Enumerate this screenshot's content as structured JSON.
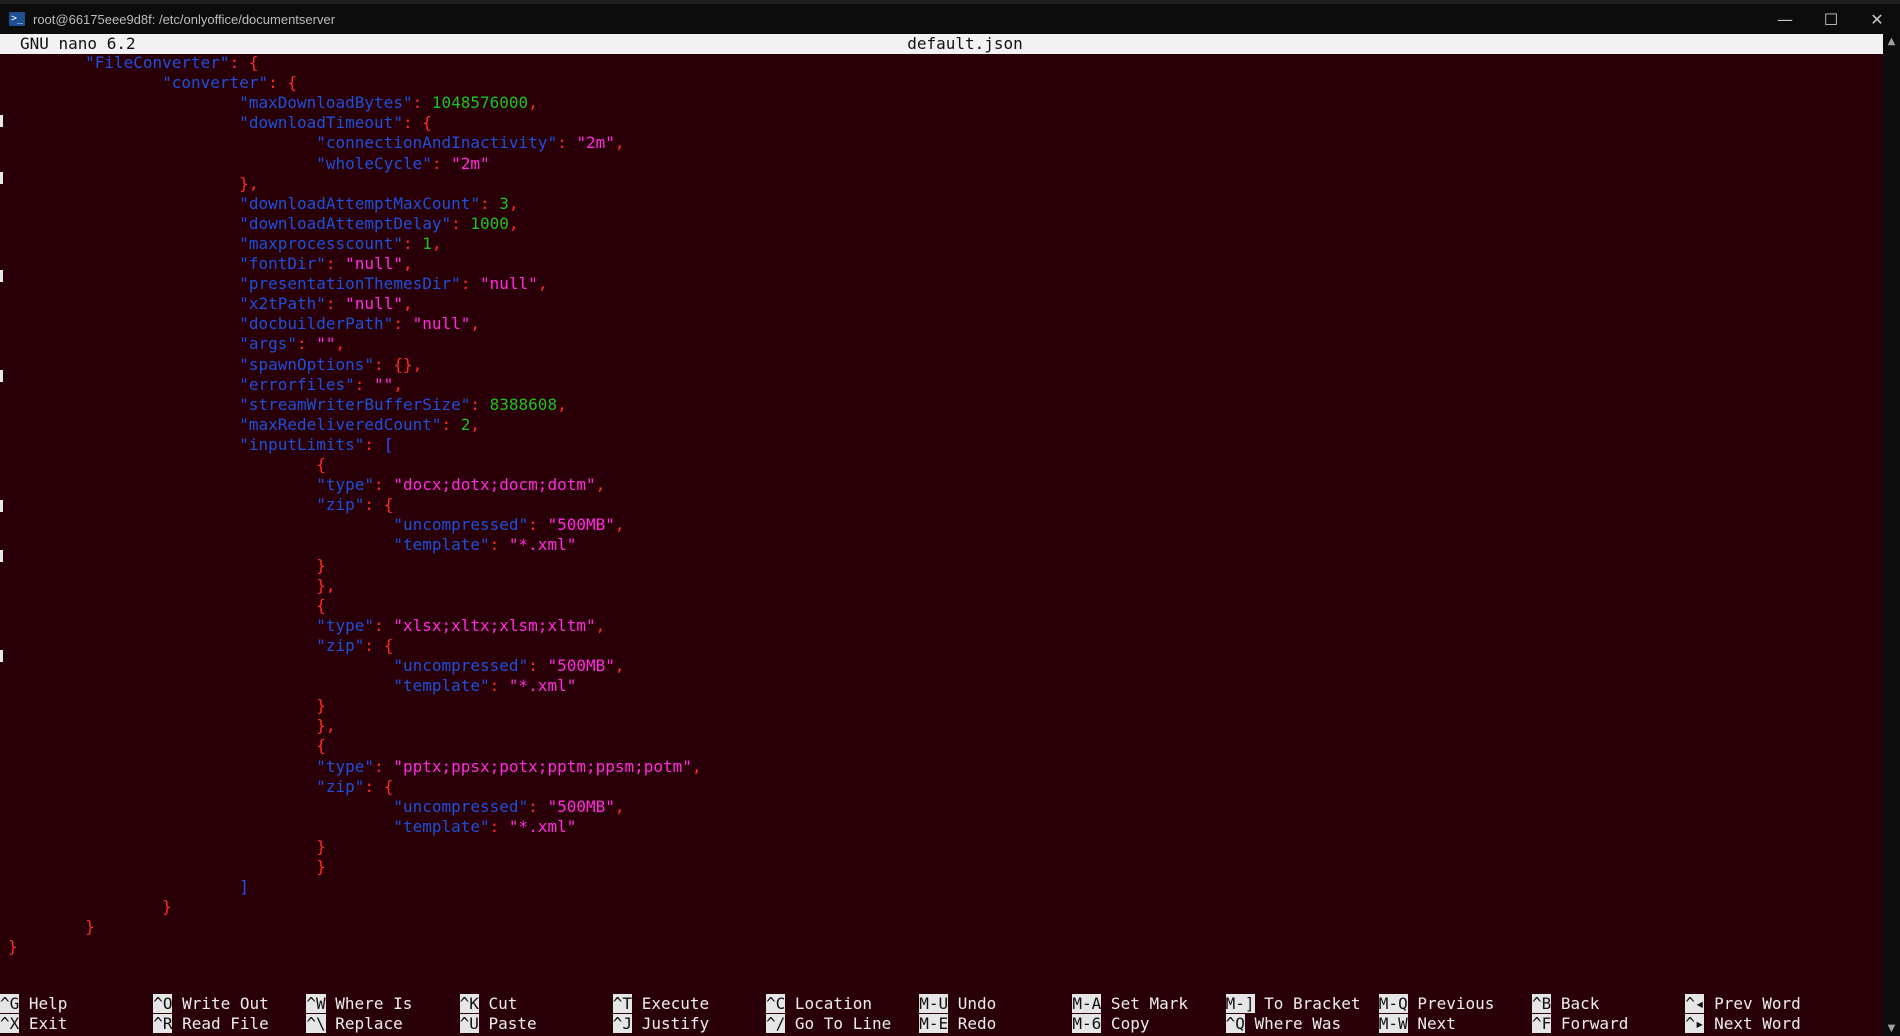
{
  "window": {
    "title": "root@66175eee9d8f: /etc/onlyoffice/documentserver",
    "icon": "powershell-icon",
    "buttons": {
      "minimize": "—",
      "maximize": "☐",
      "close": "✕"
    }
  },
  "nano": {
    "version": "GNU nano 6.2",
    "filename": "default.json"
  },
  "editor": {
    "lines": [
      [
        [
          "k",
          "\t\"FileConverter\""
        ],
        [
          "p",
          ": {"
        ]
      ],
      [
        [
          "k",
          "\t\t\"converter\""
        ],
        [
          "p",
          ": {"
        ]
      ],
      [
        [
          "k",
          "\t\t\t\"maxDownloadBytes\""
        ],
        [
          "p",
          ": "
        ],
        [
          "n",
          "1048576000"
        ],
        [
          "p",
          ","
        ]
      ],
      [
        [
          "k",
          "\t\t\t\"downloadTimeout\""
        ],
        [
          "p",
          ": {"
        ]
      ],
      [
        [
          "k",
          "\t\t\t\t\"connectionAndInactivity\""
        ],
        [
          "p",
          ": "
        ],
        [
          "s",
          "\"2m\""
        ],
        [
          "p",
          ","
        ]
      ],
      [
        [
          "k",
          "\t\t\t\t\"wholeCycle\""
        ],
        [
          "p",
          ": "
        ],
        [
          "s",
          "\"2m\""
        ]
      ],
      [
        [
          "p",
          "\t\t\t},"
        ]
      ],
      [
        [
          "k",
          "\t\t\t\"downloadAttemptMaxCount\""
        ],
        [
          "p",
          ": "
        ],
        [
          "n",
          "3"
        ],
        [
          "p",
          ","
        ]
      ],
      [
        [
          "k",
          "\t\t\t\"downloadAttemptDelay\""
        ],
        [
          "p",
          ": "
        ],
        [
          "n",
          "1000"
        ],
        [
          "p",
          ","
        ]
      ],
      [
        [
          "k",
          "\t\t\t\"maxprocesscount\""
        ],
        [
          "p",
          ": "
        ],
        [
          "n",
          "1"
        ],
        [
          "p",
          ","
        ]
      ],
      [
        [
          "k",
          "\t\t\t\"fontDir\""
        ],
        [
          "p",
          ": "
        ],
        [
          "s",
          "\"null\""
        ],
        [
          "p",
          ","
        ]
      ],
      [
        [
          "k",
          "\t\t\t\"presentationThemesDir\""
        ],
        [
          "p",
          ": "
        ],
        [
          "s",
          "\"null\""
        ],
        [
          "p",
          ","
        ]
      ],
      [
        [
          "k",
          "\t\t\t\"x2tPath\""
        ],
        [
          "p",
          ": "
        ],
        [
          "s",
          "\"null\""
        ],
        [
          "p",
          ","
        ]
      ],
      [
        [
          "k",
          "\t\t\t\"docbuilderPath\""
        ],
        [
          "p",
          ": "
        ],
        [
          "s",
          "\"null\""
        ],
        [
          "p",
          ","
        ]
      ],
      [
        [
          "k",
          "\t\t\t\"args\""
        ],
        [
          "p",
          ": "
        ],
        [
          "s",
          "\"\""
        ],
        [
          "p",
          ","
        ]
      ],
      [
        [
          "k",
          "\t\t\t\"spawnOptions\""
        ],
        [
          "p",
          ": {},"
        ]
      ],
      [
        [
          "k",
          "\t\t\t\"errorfiles\""
        ],
        [
          "p",
          ": "
        ],
        [
          "s",
          "\"\""
        ],
        [
          "p",
          ","
        ]
      ],
      [
        [
          "k",
          "\t\t\t\"streamWriterBufferSize\""
        ],
        [
          "p",
          ": "
        ],
        [
          "n",
          "8388608"
        ],
        [
          "p",
          ","
        ]
      ],
      [
        [
          "k",
          "\t\t\t\"maxRedeliveredCount\""
        ],
        [
          "p",
          ": "
        ],
        [
          "n",
          "2"
        ],
        [
          "p",
          ","
        ]
      ],
      [
        [
          "k",
          "\t\t\t\"inputLimits\""
        ],
        [
          "p",
          ": "
        ],
        [
          "b",
          "["
        ]
      ],
      [
        [
          "p",
          "\t\t\t\t{"
        ]
      ],
      [
        [
          "k",
          "\t\t\t\t\"type\""
        ],
        [
          "p",
          ": "
        ],
        [
          "s",
          "\"docx;dotx;docm;dotm\""
        ],
        [
          "p",
          ","
        ]
      ],
      [
        [
          "k",
          "\t\t\t\t\"zip\""
        ],
        [
          "p",
          ": {"
        ]
      ],
      [
        [
          "k",
          "\t\t\t\t\t\"uncompressed\""
        ],
        [
          "p",
          ": "
        ],
        [
          "s",
          "\"500MB\""
        ],
        [
          "p",
          ","
        ]
      ],
      [
        [
          "k",
          "\t\t\t\t\t\"template\""
        ],
        [
          "p",
          ": "
        ],
        [
          "s",
          "\"*.xml\""
        ]
      ],
      [
        [
          "p",
          "\t\t\t\t}"
        ]
      ],
      [
        [
          "p",
          "\t\t\t\t},"
        ]
      ],
      [
        [
          "p",
          "\t\t\t\t{"
        ]
      ],
      [
        [
          "k",
          "\t\t\t\t\"type\""
        ],
        [
          "p",
          ": "
        ],
        [
          "s",
          "\"xlsx;xltx;xlsm;xltm\""
        ],
        [
          "p",
          ","
        ]
      ],
      [
        [
          "k",
          "\t\t\t\t\"zip\""
        ],
        [
          "p",
          ": {"
        ]
      ],
      [
        [
          "k",
          "\t\t\t\t\t\"uncompressed\""
        ],
        [
          "p",
          ": "
        ],
        [
          "s",
          "\"500MB\""
        ],
        [
          "p",
          ","
        ]
      ],
      [
        [
          "k",
          "\t\t\t\t\t\"template\""
        ],
        [
          "p",
          ": "
        ],
        [
          "s",
          "\"*.xml\""
        ]
      ],
      [
        [
          "p",
          "\t\t\t\t}"
        ]
      ],
      [
        [
          "p",
          "\t\t\t\t},"
        ]
      ],
      [
        [
          "p",
          "\t\t\t\t{"
        ]
      ],
      [
        [
          "k",
          "\t\t\t\t\"type\""
        ],
        [
          "p",
          ": "
        ],
        [
          "s",
          "\"pptx;ppsx;potx;pptm;ppsm;potm\""
        ],
        [
          "p",
          ","
        ]
      ],
      [
        [
          "k",
          "\t\t\t\t\"zip\""
        ],
        [
          "p",
          ": {"
        ]
      ],
      [
        [
          "k",
          "\t\t\t\t\t\"uncompressed\""
        ],
        [
          "p",
          ": "
        ],
        [
          "s",
          "\"500MB\""
        ],
        [
          "p",
          ","
        ]
      ],
      [
        [
          "k",
          "\t\t\t\t\t\"template\""
        ],
        [
          "p",
          ": "
        ],
        [
          "s",
          "\"*.xml\""
        ]
      ],
      [
        [
          "p",
          "\t\t\t\t}"
        ]
      ],
      [
        [
          "p",
          "\t\t\t\t}"
        ]
      ],
      [
        [
          "b",
          "\t\t\t]"
        ]
      ],
      [
        [
          "p",
          "\t\t}"
        ]
      ],
      [
        [
          "p",
          "\t}"
        ]
      ],
      [
        [
          "p",
          "}"
        ]
      ]
    ]
  },
  "shortcuts": [
    [
      {
        "key": "^G",
        "label": "Help"
      },
      {
        "key": "^X",
        "label": "Exit"
      }
    ],
    [
      {
        "key": "^O",
        "label": "Write Out"
      },
      {
        "key": "^R",
        "label": "Read File"
      }
    ],
    [
      {
        "key": "^W",
        "label": "Where Is"
      },
      {
        "key": "^\\",
        "label": "Replace"
      }
    ],
    [
      {
        "key": "^K",
        "label": "Cut"
      },
      {
        "key": "^U",
        "label": "Paste"
      }
    ],
    [
      {
        "key": "^T",
        "label": "Execute"
      },
      {
        "key": "^J",
        "label": "Justify"
      }
    ],
    [
      {
        "key": "^C",
        "label": "Location"
      },
      {
        "key": "^/",
        "label": "Go To Line"
      }
    ],
    [
      {
        "key": "M-U",
        "label": "Undo"
      },
      {
        "key": "M-E",
        "label": "Redo"
      }
    ],
    [
      {
        "key": "M-A",
        "label": "Set Mark"
      },
      {
        "key": "M-6",
        "label": "Copy"
      }
    ],
    [
      {
        "key": "M-]",
        "label": "To Bracket"
      },
      {
        "key": "^Q",
        "label": "Where Was"
      }
    ],
    [
      {
        "key": "M-Q",
        "label": "Previous"
      },
      {
        "key": "M-W",
        "label": "Next"
      }
    ],
    [
      {
        "key": "^B",
        "label": "Back"
      },
      {
        "key": "^F",
        "label": "Forward"
      }
    ],
    [
      {
        "key": "^◂",
        "label": "Prev Word"
      },
      {
        "key": "^▸",
        "label": "Next Word"
      }
    ]
  ],
  "colors": {
    "background": "#2a0008",
    "key": "#1f4fd8",
    "string": "#ff2be0",
    "number": "#1ec21e",
    "punct": "#ff2a2a"
  }
}
